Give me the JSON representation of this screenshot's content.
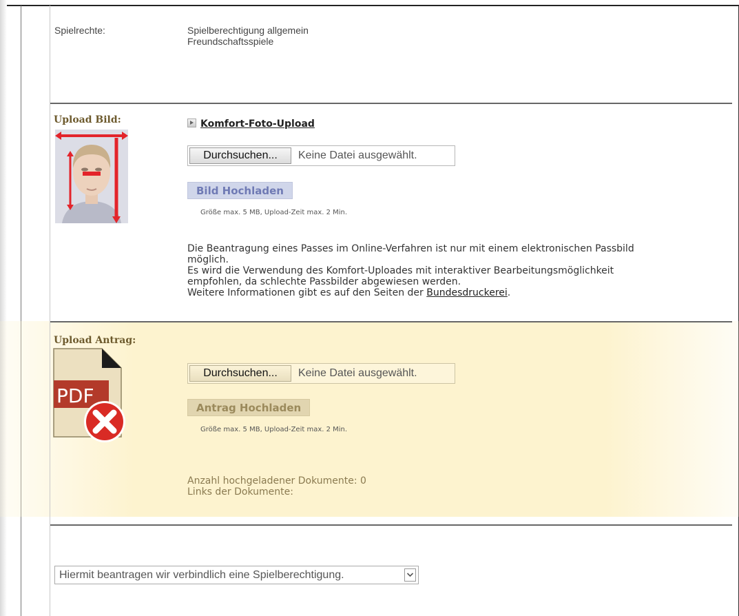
{
  "spielrechte": {
    "label": "Spielrechte:",
    "lines": [
      "Spielberechtigung allgemein",
      "Freundschaftsspiele"
    ]
  },
  "upload_bild": {
    "label": "Upload Bild:",
    "komfort_link": "Komfort-Foto-Upload",
    "browse_label": "Durchsuchen...",
    "file_status": "Keine Datei ausgewählt.",
    "upload_button": "Bild Hochladen",
    "hint": "Größe max. 5 MB, Upload-Zeit max. 2 Min.",
    "info_lines": [
      "Die Beantragung eines Passes im Online-Verfahren ist nur mit einem elektronischen Passbild",
      "möglich.",
      "Es wird die Verwendung des Komfort-Uploades mit interaktiver Bearbeitungsmöglichkeit",
      "empfohlen, da schlechte Passbilder abgewiesen werden."
    ],
    "info_more_prefix": "Weitere Informationen gibt es auf den Seiten der ",
    "info_more_link": "Bundesdruckerei",
    "info_more_suffix": "."
  },
  "upload_antrag": {
    "label": "Upload Antrag:",
    "pdf_text": "PDF",
    "browse_label": "Durchsuchen...",
    "file_status": "Keine Datei ausgewählt.",
    "upload_button": "Antrag Hochladen",
    "hint": "Größe max. 5 MB, Upload-Zeit max. 2 Min.",
    "count_text": "Anzahl hochgeladener Dokumente: 0",
    "links_text": "Links der Dokumente:"
  },
  "antrag_select": {
    "selected": "Hiermit beantragen wir verbindlich eine Spielberechtigung."
  },
  "colors": {
    "highlight_bg": "#fdf3cf",
    "label_brown": "#6d5a2d",
    "button_blue_bg": "#d0d6ea",
    "button_tan_bg": "#e1d5b0",
    "red": "#e3242b"
  }
}
